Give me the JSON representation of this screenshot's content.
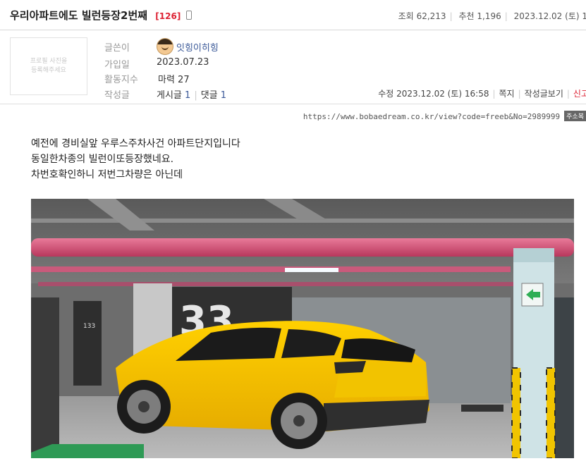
{
  "post": {
    "title": "우리아파트에도 빌런등장2번째",
    "comment_count": "[126]",
    "views_label": "조회",
    "views": "62,213",
    "recommend_label": "추천",
    "recommend": "1,196",
    "date": "2023.12.02",
    "weekday": "(토) 1"
  },
  "profile": {
    "placeholder": "프로필 사진을\n등록해주세요",
    "author_label": "글쓴이",
    "author": "잇힝이히힝",
    "joined_label": "가입일",
    "joined": "2023.07.23",
    "activity_label": "활동지수",
    "activity": "마력 27",
    "posts_label": "작성글",
    "posts_text": "게시글",
    "posts_count": "1",
    "comments_text": "댓글",
    "comments_count": "1"
  },
  "actions": {
    "modified": "수정 2023.12.02 (토) 16:58",
    "message": "쪽지",
    "view_posts": "작성글보기",
    "report": "신고"
  },
  "url": {
    "text": "https://www.bobaedream.co.kr/view?code=freeb&No=2989999",
    "copy_label": "주소복"
  },
  "content": {
    "lines": [
      "예전에 경비실앞 우루스주차사건 아파트단지입니다",
      "동일한차종의 빌런이또등장했네요.",
      "차번호확인하니 저번그차량은 아닌데"
    ],
    "photo_pillar_number": "33",
    "photo_sign_number": "133"
  }
}
